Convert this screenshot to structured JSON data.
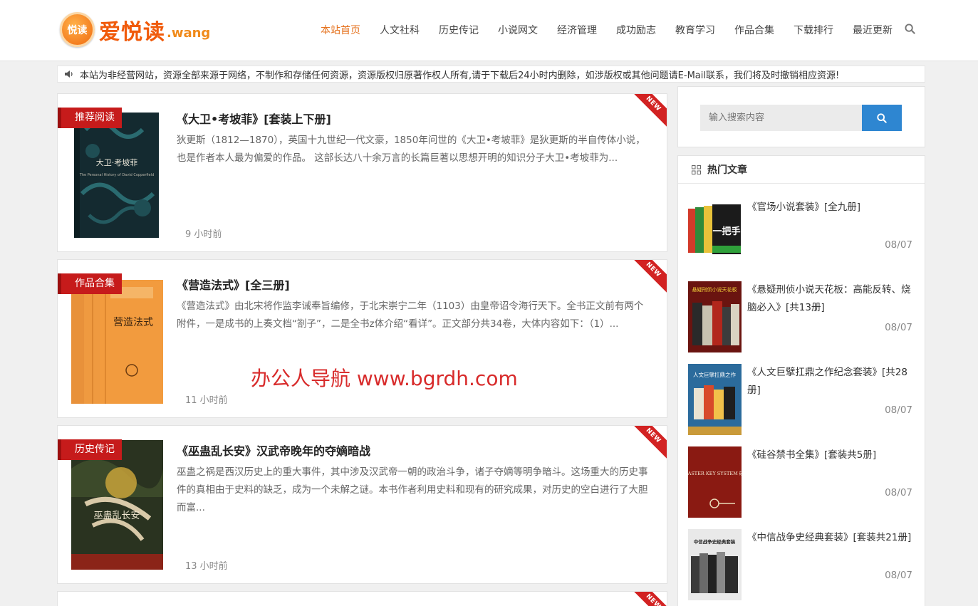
{
  "logo": {
    "badge": "悦读",
    "name": "爱悦读",
    "suffix": ".wang"
  },
  "nav": [
    {
      "label": "本站首页",
      "active": true
    },
    {
      "label": "人文社科"
    },
    {
      "label": "历史传记"
    },
    {
      "label": "小说网文"
    },
    {
      "label": "经济管理"
    },
    {
      "label": "成功励志"
    },
    {
      "label": "教育学习"
    },
    {
      "label": "作品合集"
    },
    {
      "label": "下载排行"
    },
    {
      "label": "最近更新"
    }
  ],
  "notice": "本站为非经营网站，资源全部来源于网络，不制作和存储任何资源，资源版权归原著作权人所有,请于下载后24小时内删除，如涉版权或其他问题请E-Mail联系，我们将及时撤销相应资源!",
  "posts": [
    {
      "category": "推荐阅读",
      "badge": "NEW",
      "title": "《大卫•考坡菲》[套装上下册]",
      "excerpt": "狄更斯（1812—1870），英国十九世纪一代文豪，1850年问世的《大卫•考坡菲》是狄更斯的半自传体小说，也是作者本人最为偏爱的作品。 这部长达八十余万言的长篇巨著以思想开明的知识分子大卫•考坡菲为...",
      "time": "9 小时前",
      "cover": {
        "title": "大卫·考坡菲",
        "subtitle": "The Personal History of David Copperfield"
      }
    },
    {
      "category": "作品合集",
      "badge": "NEW",
      "title": "《营造法式》[全三册]",
      "excerpt": "《营造法式》由北宋将作监李诫奉旨编修，于北宋崇宁二年（1103）由皇帝诏令海行天下。全书正文前有两个附件，一是成书的上奏文档“劄子”，二是全书z体介绍“看详”。正文部分共34卷，大体内容如下：（1）...",
      "time": "11 小时前",
      "cover": {
        "title": "营造法式"
      }
    },
    {
      "category": "历史传记",
      "badge": "NEW",
      "title": "《巫蛊乱长安》汉武帝晚年的夺嫡暗战",
      "excerpt": "巫蛊之祸是西汉历史上的重大事件，其中涉及汉武帝一朝的政治斗争，诸子夺嫡等明争暗斗。这场重大的历史事件的真相由于史料的缺乏，成为一个未解之谜。本书作者利用史料和现有的研究成果，对历史的空白进行了大胆而富...",
      "time": "13 小时前",
      "cover": {
        "title": "巫蛊乱长安"
      }
    }
  ],
  "post4_badge": "NEW",
  "watermark": "办公人导航 www.bgrdh.com",
  "sidebar": {
    "search_placeholder": "输入搜索内容",
    "hot_title": "热门文章",
    "hot": [
      {
        "title": "《官场小说套装》[全九册]",
        "date": "08/07",
        "cover_text": "一把手"
      },
      {
        "title": "《悬疑刑侦小说天花板：高能反转、烧脑必入》[共13册]",
        "date": "08/07",
        "cover_text": "悬疑刑侦小说天花板"
      },
      {
        "title": "《人文巨擘扛鼎之作纪念套装》[共28册]",
        "date": "08/07",
        "cover_text": "人文巨擘扛鼎之作"
      },
      {
        "title": "《硅谷禁书全集》[套装共5册]",
        "date": "08/07",
        "cover_text": "THE MASTER KEY SYSTEM 硅谷禁书"
      },
      {
        "title": "《中信战争史经典套装》[套装共21册]",
        "date": "08/07",
        "cover_text": "中信战争史经典套装"
      }
    ]
  },
  "colors": {
    "accent": "#e5721e",
    "tag": "#c61b1b",
    "button": "#2e86d1"
  }
}
